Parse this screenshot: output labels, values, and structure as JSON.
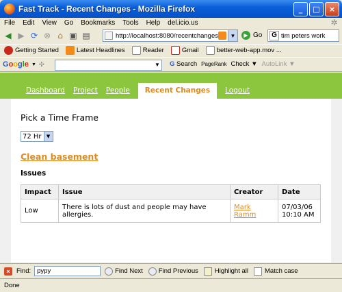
{
  "window": {
    "title": "Fast Track - Recent Changes - Mozilla Firefox",
    "minimize": "_",
    "maximize": "□",
    "close": "×"
  },
  "menu": [
    "File",
    "Edit",
    "View",
    "Go",
    "Bookmarks",
    "Tools",
    "Help",
    "del.icio.us"
  ],
  "nav": {
    "url": "http://localhost:8080/recentchanges/",
    "go_label": "Go",
    "search_value": "tim peters work"
  },
  "bookmarks": [
    "Getting Started",
    "Latest Headlines",
    "Reader",
    "Gmail",
    "better-web-app.mov ..."
  ],
  "google_toolbar": {
    "logo": [
      "G",
      "o",
      "o",
      "g",
      "l",
      "e"
    ],
    "search_label": "Search",
    "pagerank_label": "PageRank",
    "check_label": "Check",
    "autolink_label": "AutoLink"
  },
  "site": {
    "nav_links": [
      "Dashboard",
      "Project",
      "People"
    ],
    "active_tab": "Recent Changes",
    "logout": "Logout",
    "accent": "#e08a1e",
    "nav_color": "#8cc63f"
  },
  "main": {
    "heading": "Pick a Time Frame",
    "timeframe_selected": "72 Hr",
    "task_link": "Clean basement",
    "issues_heading": "Issues",
    "table": {
      "headers": [
        "Impact",
        "Issue",
        "Creator",
        "Date"
      ],
      "rows": [
        {
          "impact": "Low",
          "issue": "There is lots of dust and people may have allergies.",
          "creator": "Mark Ramm",
          "date": "07/03/06 10:10 AM"
        }
      ]
    }
  },
  "findbar": {
    "label": "Find:",
    "value": "pypy",
    "find_next": "Find Next",
    "find_previous": "Find Previous",
    "highlight_all": "Highlight all",
    "match_case": "Match case"
  },
  "status": "Done"
}
